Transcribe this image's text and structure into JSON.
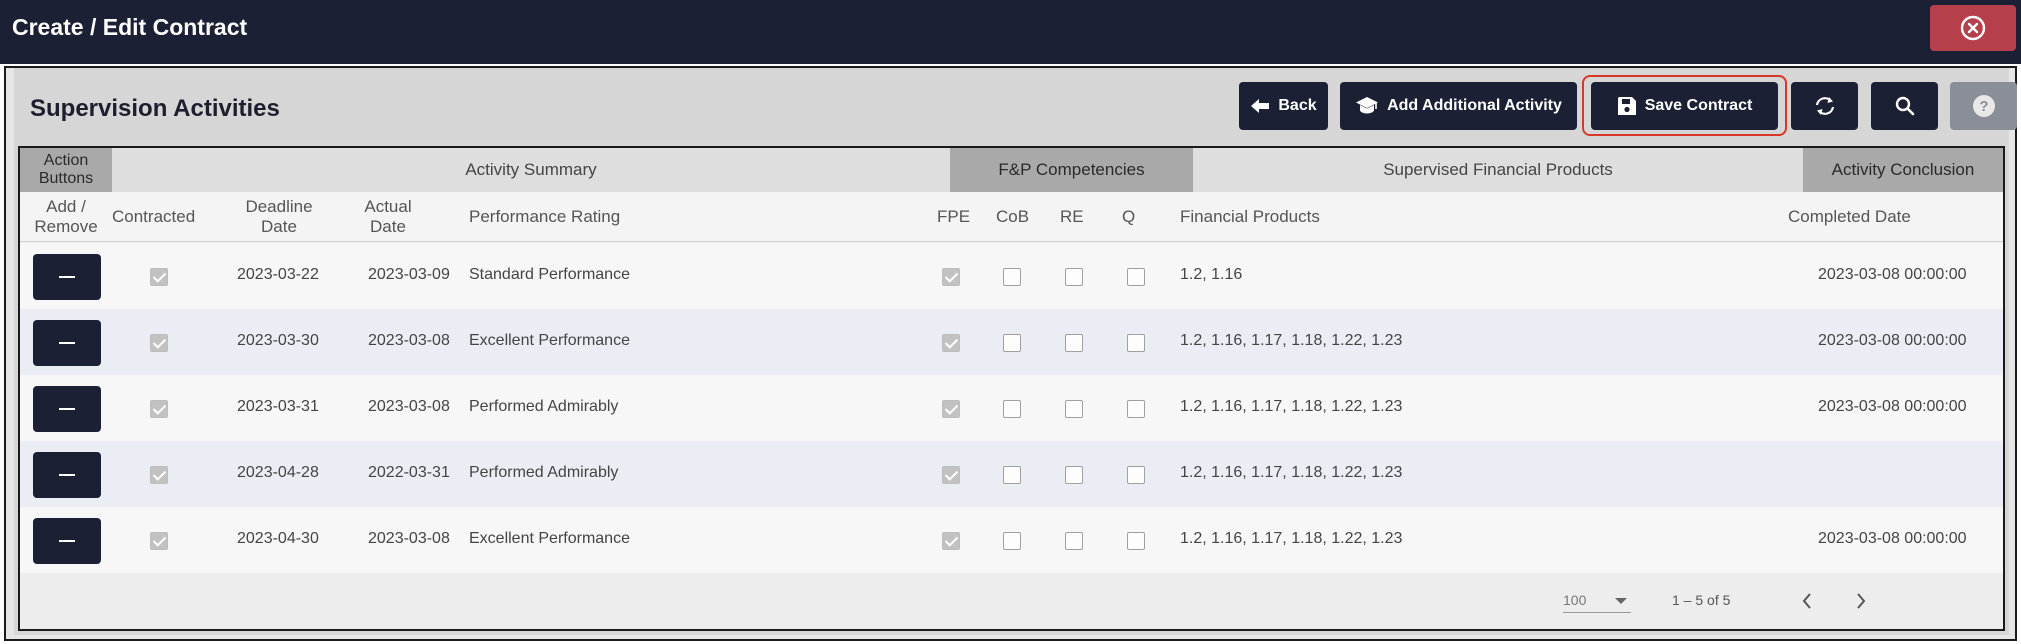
{
  "window": {
    "title": "Create / Edit Contract",
    "close_icon": "close-circle-icon"
  },
  "panel": {
    "title": "Supervision Activities"
  },
  "toolbar": {
    "back_label": "Back",
    "add_activity_label": "Add Additional Activity",
    "save_label": "Save Contract",
    "refresh_icon": "refresh-icon",
    "search_icon": "search-icon",
    "help_icon": "help-icon"
  },
  "table": {
    "groups": {
      "action_buttons": "Action Buttons",
      "activity_summary": "Activity Summary",
      "fp_competencies": "F&P Competencies",
      "supervised_products": "Supervised Financial Products",
      "activity_conclusion": "Activity Conclusion"
    },
    "columns": {
      "add_remove": "Add / Remove",
      "contracted": "Contracted",
      "deadline_date": "Deadline Date",
      "actual_date": "Actual Date",
      "performance_rating": "Performance Rating",
      "fpe": "FPE",
      "cob": "CoB",
      "re": "RE",
      "q": "Q",
      "financial_products": "Financial Products",
      "completed_date": "Completed Date"
    },
    "rows": [
      {
        "contracted": true,
        "deadline": "2023-03-22",
        "actual": "2023-03-09",
        "rating": "Standard Performance",
        "fpe": true,
        "cob": false,
        "re": false,
        "q": false,
        "products": "1.2, 1.16",
        "completed": "2023-03-08 00:00:00"
      },
      {
        "contracted": true,
        "deadline": "2023-03-30",
        "actual": "2023-03-08",
        "rating": "Excellent Performance",
        "fpe": true,
        "cob": false,
        "re": false,
        "q": false,
        "products": "1.2, 1.16, 1.17, 1.18, 1.22, 1.23",
        "completed": "2023-03-08 00:00:00"
      },
      {
        "contracted": true,
        "deadline": "2023-03-31",
        "actual": "2023-03-08",
        "rating": "Performed Admirably",
        "fpe": true,
        "cob": false,
        "re": false,
        "q": false,
        "products": "1.2, 1.16, 1.17, 1.18, 1.22, 1.23",
        "completed": "2023-03-08 00:00:00"
      },
      {
        "contracted": true,
        "deadline": "2023-04-28",
        "actual": "2022-03-31",
        "rating": "Performed Admirably",
        "fpe": true,
        "cob": false,
        "re": false,
        "q": false,
        "products": "1.2, 1.16, 1.17, 1.18, 1.22, 1.23",
        "completed": ""
      },
      {
        "contracted": true,
        "deadline": "2023-04-30",
        "actual": "2023-03-08",
        "rating": "Excellent Performance",
        "fpe": true,
        "cob": false,
        "re": false,
        "q": false,
        "products": "1.2, 1.16, 1.17, 1.18, 1.22, 1.23",
        "completed": "2023-03-08 00:00:00"
      }
    ]
  },
  "paginator": {
    "page_size": "100",
    "range": "1 – 5 of 5"
  }
}
